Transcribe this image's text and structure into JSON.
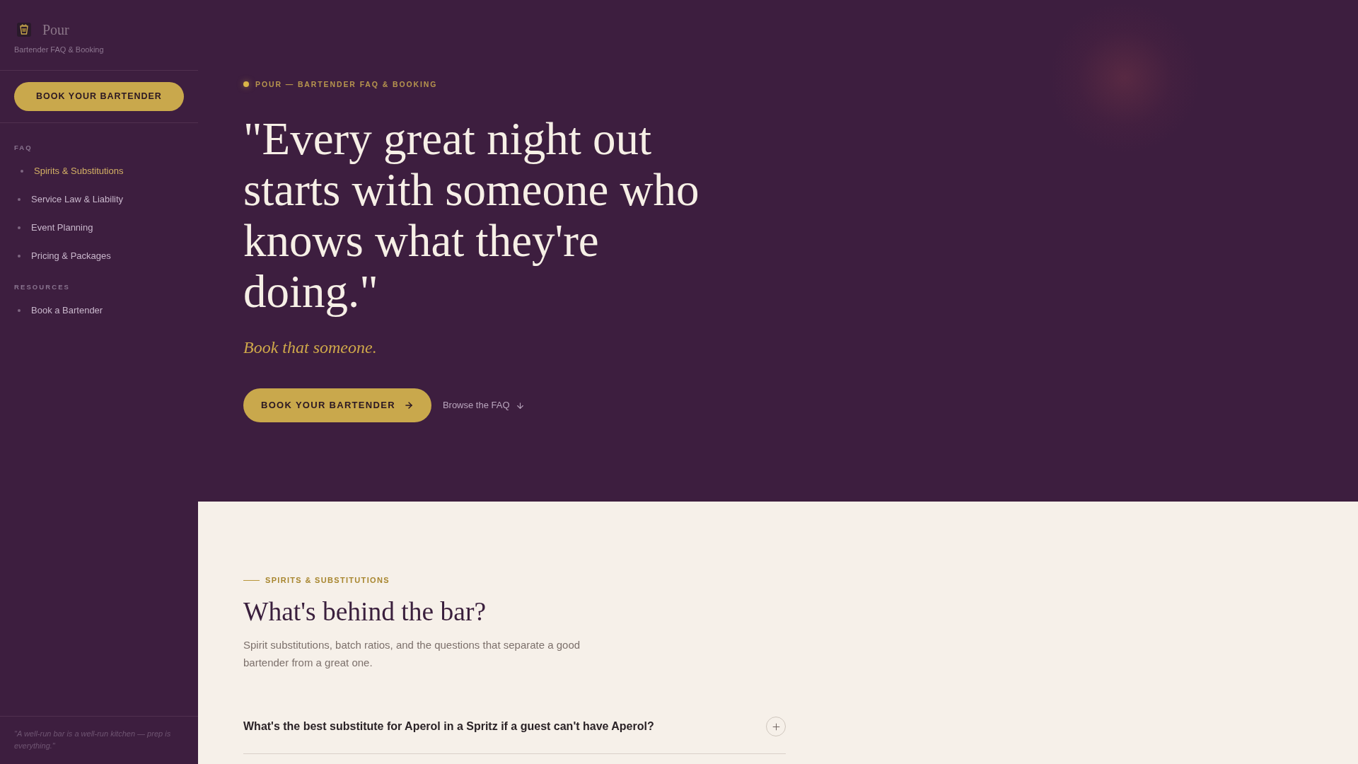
{
  "sidebar": {
    "brand": {
      "name": "Pour",
      "tagline": "Bartender FAQ & Booking"
    },
    "cta": "BOOK YOUR BARTENDER",
    "sections": [
      {
        "heading": "FAQ",
        "items": [
          {
            "label": "Spirits & Substitutions",
            "selected": true
          },
          {
            "label": "Service Law & Liability",
            "selected": false
          },
          {
            "label": "Event Planning",
            "selected": false
          },
          {
            "label": "Pricing & Packages",
            "selected": false
          }
        ]
      },
      {
        "heading": "RESOURCES",
        "items": [
          {
            "label": "Book a Bartender",
            "selected": false
          }
        ]
      }
    ],
    "quote": "\"A well-run bar is a well-run kitchen — prep is everything.\""
  },
  "hero": {
    "eyebrow": "POUR — BARTENDER FAQ & BOOKING",
    "headline": "\"Every great night out starts with someone who knows what they're doing.\"",
    "tagline": "Book that someone.",
    "primary_button": "BOOK YOUR BARTENDER",
    "secondary_link": "Browse the FAQ"
  },
  "faq_section": {
    "eyebrow": "SPIRITS & SUBSTITUTIONS",
    "title": "What's behind the bar?",
    "description": "Spirit substitutions, batch ratios, and the questions that separate a good bartender from a great one.",
    "questions": [
      {
        "question": "What's the best substitute for Aperol in a Spritz if a guest can't have Aperol?",
        "expanded": false
      }
    ]
  }
}
